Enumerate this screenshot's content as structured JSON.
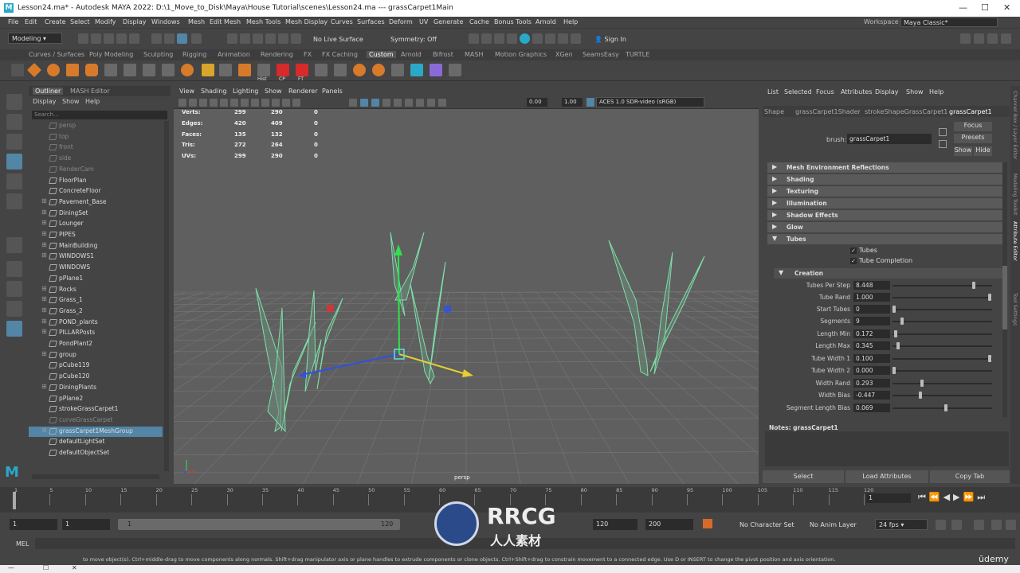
{
  "title": {
    "text": "Lesson24.ma* - Autodesk MAYA 2022: D:\\1_Move_to_Disk\\Maya\\House Tutorial\\scenes\\Lesson24.ma  ---  grassCarpet1Main"
  },
  "menu": [
    "File",
    "Edit",
    "Create",
    "Select",
    "Modify",
    "Display",
    "Windows",
    "Mesh",
    "Edit Mesh",
    "Mesh Tools",
    "Mesh Display",
    "Curves",
    "Surfaces",
    "Deform",
    "UV",
    "Generate",
    "Cache",
    "Bonus Tools",
    "Arnold",
    "Help"
  ],
  "workspace": {
    "label": "Workspace :",
    "value": "Maya Classic*"
  },
  "status": {
    "mode": "Modeling",
    "live": "No Live Surface",
    "symmetry": "Symmetry: Off",
    "signin": "Sign In"
  },
  "shelf_tabs": [
    "Curves / Surfaces",
    "Poly Modeling",
    "Sculpting",
    "Rigging",
    "Animation",
    "Rendering",
    "FX",
    "FX Caching",
    "Custom",
    "Arnold",
    "Bifrost",
    "MASH",
    "Motion Graphics",
    "XGen",
    "SeamsEasy",
    "TURTLE"
  ],
  "shelf_labels": {
    "hist": "Hist",
    "cp": "CP",
    "ft": "FT"
  },
  "outliner": {
    "tabs": [
      "Outliner",
      "MASH Editor"
    ],
    "menu": [
      "Display",
      "Show",
      "Help"
    ],
    "search": "Search...",
    "items": [
      {
        "label": "persp",
        "exp": false,
        "dim": true
      },
      {
        "label": "top",
        "exp": false,
        "dim": true
      },
      {
        "label": "front",
        "exp": false,
        "dim": true
      },
      {
        "label": "side",
        "exp": false,
        "dim": true
      },
      {
        "label": "RenderCam",
        "exp": false,
        "dim": true
      },
      {
        "label": "FloorPlan",
        "exp": false,
        "dim": false
      },
      {
        "label": "ConcreteFloor",
        "exp": false,
        "dim": false
      },
      {
        "label": "Pavement_Base",
        "exp": true,
        "dim": false
      },
      {
        "label": "DiningSet",
        "exp": true,
        "dim": false
      },
      {
        "label": "Lounger",
        "exp": true,
        "dim": false
      },
      {
        "label": "PIPES",
        "exp": true,
        "dim": false
      },
      {
        "label": "MainBuilding",
        "exp": true,
        "dim": false
      },
      {
        "label": "WINDOWS1",
        "exp": true,
        "dim": false
      },
      {
        "label": "WINDOWS",
        "exp": false,
        "dim": false
      },
      {
        "label": "pPlane1",
        "exp": false,
        "dim": false
      },
      {
        "label": "Rocks",
        "exp": true,
        "dim": false
      },
      {
        "label": "Grass_1",
        "exp": true,
        "dim": false
      },
      {
        "label": "Grass_2",
        "exp": true,
        "dim": false
      },
      {
        "label": "POND_plants",
        "exp": true,
        "dim": false
      },
      {
        "label": "PILLARPosts",
        "exp": true,
        "dim": false
      },
      {
        "label": "PondPlant2",
        "exp": false,
        "dim": false
      },
      {
        "label": "group",
        "exp": true,
        "dim": false
      },
      {
        "label": "pCube119",
        "exp": false,
        "dim": false
      },
      {
        "label": "pCube120",
        "exp": false,
        "dim": false
      },
      {
        "label": "DiningPlants",
        "exp": true,
        "dim": false
      },
      {
        "label": "pPlane2",
        "exp": false,
        "dim": false
      },
      {
        "label": "strokeGrassCarpet1",
        "exp": false,
        "dim": false
      },
      {
        "label": "curveGrassCarpet",
        "exp": false,
        "dim": true
      },
      {
        "label": "grassCarpet1MeshGroup",
        "exp": true,
        "dim": false,
        "sel": true
      },
      {
        "label": "defaultLightSet",
        "exp": false,
        "dim": false
      },
      {
        "label": "defaultObjectSet",
        "exp": false,
        "dim": false
      }
    ]
  },
  "viewport": {
    "menu": [
      "View",
      "Shading",
      "Lighting",
      "Show",
      "Renderer",
      "Panels"
    ],
    "val1": "0.00",
    "val2": "1.00",
    "colorspace": "ACES 1.0 SDR-video (sRGB)",
    "camera": "persp",
    "hud": [
      [
        "Verts:",
        "299",
        "290",
        "0"
      ],
      [
        "Edges:",
        "420",
        "409",
        "0"
      ],
      [
        "Faces:",
        "135",
        "132",
        "0"
      ],
      [
        "Tris:",
        "272",
        "264",
        "0"
      ],
      [
        "UVs:",
        "299",
        "290",
        "0"
      ]
    ]
  },
  "attr": {
    "menu": [
      "List",
      "Selected",
      "Focus",
      "Attributes",
      "Display",
      "Show",
      "Help"
    ],
    "tabs": [
      "Shape",
      "grassCarpet1Shader",
      "strokeShapeGrassCarpet1",
      "grassCarpet1"
    ],
    "brush_label": "brush:",
    "brush_value": "grassCarpet1",
    "buttons": [
      "Focus",
      "Presets",
      "Show",
      "Hide"
    ],
    "sections": [
      {
        "label": "Mesh Environment Reflections",
        "open": false
      },
      {
        "label": "Shading",
        "open": false
      },
      {
        "label": "Texturing",
        "open": false
      },
      {
        "label": "Illumination",
        "open": false
      },
      {
        "label": "Shadow Effects",
        "open": false
      },
      {
        "label": "Glow",
        "open": false
      },
      {
        "label": "Tubes",
        "open": true
      }
    ],
    "checks": [
      "Tubes",
      "Tube Completion"
    ],
    "creation": "Creation",
    "fields": [
      {
        "label": "Tubes Per Step",
        "value": "8.448",
        "pos": 0.82
      },
      {
        "label": "Tube Rand",
        "value": "1.000",
        "pos": 0.98
      },
      {
        "label": "Start Tubes",
        "value": "0",
        "pos": 0.0
      },
      {
        "label": "Segments",
        "value": "9",
        "pos": 0.08
      },
      {
        "label": "Length Min",
        "value": "0.172",
        "pos": 0.02
      },
      {
        "label": "Length Max",
        "value": "0.345",
        "pos": 0.04
      },
      {
        "label": "Tube Width 1",
        "value": "0.100",
        "pos": 0.98
      },
      {
        "label": "Tube Width 2",
        "value": "0.000",
        "pos": 0.0
      },
      {
        "label": "Width Rand",
        "value": "0.293",
        "pos": 0.29
      },
      {
        "label": "Width Bias",
        "value": "-0.447",
        "pos": 0.27
      },
      {
        "label": "Segment Length Bias",
        "value": "0.069",
        "pos": 0.53
      }
    ],
    "notes": "Notes:  grassCarpet1",
    "bottom": [
      "Select",
      "Load Attributes",
      "Copy Tab"
    ]
  },
  "side_tabs": [
    "Channel Box / Layer Editor",
    "Modeling Toolkit",
    "Attribute Editor",
    "Tool Settings"
  ],
  "timeline": {
    "ticks": [
      "1",
      "5",
      "10",
      "15",
      "20",
      "25",
      "30",
      "35",
      "40",
      "45",
      "50",
      "55",
      "60",
      "65",
      "70",
      "75",
      "80",
      "85",
      "90",
      "95",
      "100",
      "105",
      "110",
      "115",
      "120"
    ],
    "current": "1"
  },
  "range": {
    "start": "1",
    "start2": "1",
    "slider_start": "1",
    "slider_end": "120",
    "end": "120",
    "end2": "200",
    "character": "No Character Set",
    "anim": "No Anim Layer",
    "fps": "24 fps"
  },
  "cmd": {
    "label": "MEL"
  },
  "help": {
    "text": "to move object(s). Ctrl+middle-drag to move components along normals. Shift+drag manipulator axis or plane handles to extrude components or clone objects. Ctrl+Shift+drag to constrain movement to a connected edge. Use D or INSERT to change the pivot position and axis orientation."
  },
  "watermark": {
    "brand": "RRCG",
    "sub": "人人素材"
  },
  "udemy": "ūdemy",
  "colors": {
    "accent": "#5285a6",
    "mesh": "#7de0a8",
    "axis_x": "#e53030",
    "axis_y": "#30e050",
    "axis_z": "#3050e5"
  }
}
